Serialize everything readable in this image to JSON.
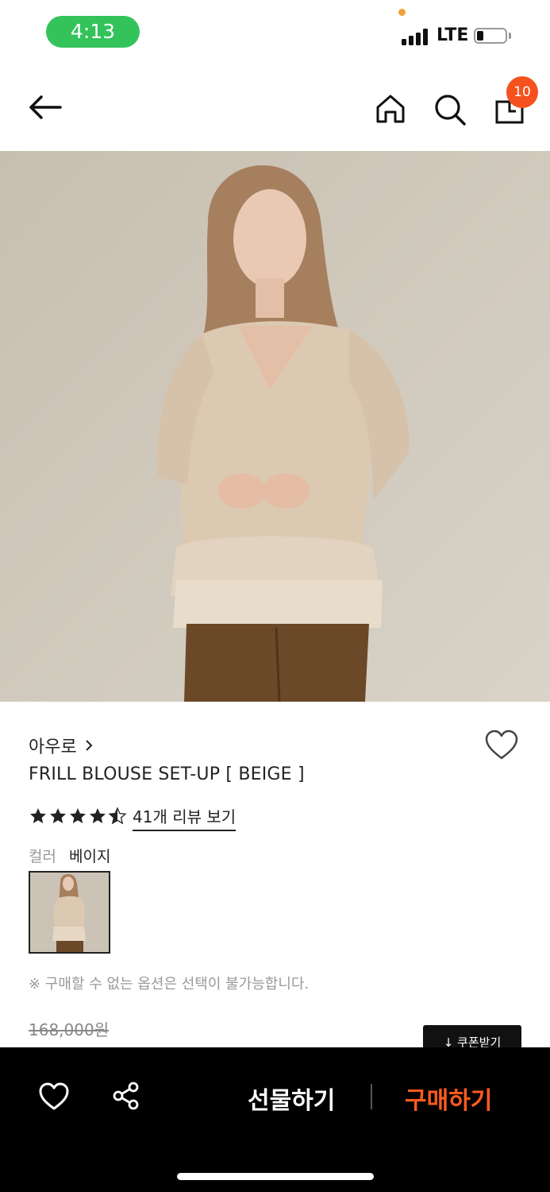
{
  "status_bar": {
    "time": "4:13",
    "network": "LTE"
  },
  "header": {
    "cart_count": "10"
  },
  "product": {
    "brand": "아우로",
    "name": "FRILL BLOUSE SET-UP [ BEIGE ]",
    "rating": 4.5,
    "review_link": "41개 리뷰 보기",
    "color_label": "컬러",
    "color_value": "베이지",
    "notice": "※ 구매할 수 없는 옵션은 선택이 불가능합니다.",
    "original_price": "168,000원",
    "coupon_button": "↓ 쿠폰받기"
  },
  "bottom_bar": {
    "gift_label": "선물하기",
    "buy_label": "구매하기"
  },
  "colors": {
    "accent": "#ff5a1f",
    "badge": "#f4511e",
    "time_pill": "#33c35a"
  },
  "icons": [
    "back-arrow-icon",
    "home-icon",
    "search-icon",
    "shopping-bag-icon",
    "heart-icon",
    "share-icon",
    "chevron-right-icon",
    "star-icon"
  ]
}
